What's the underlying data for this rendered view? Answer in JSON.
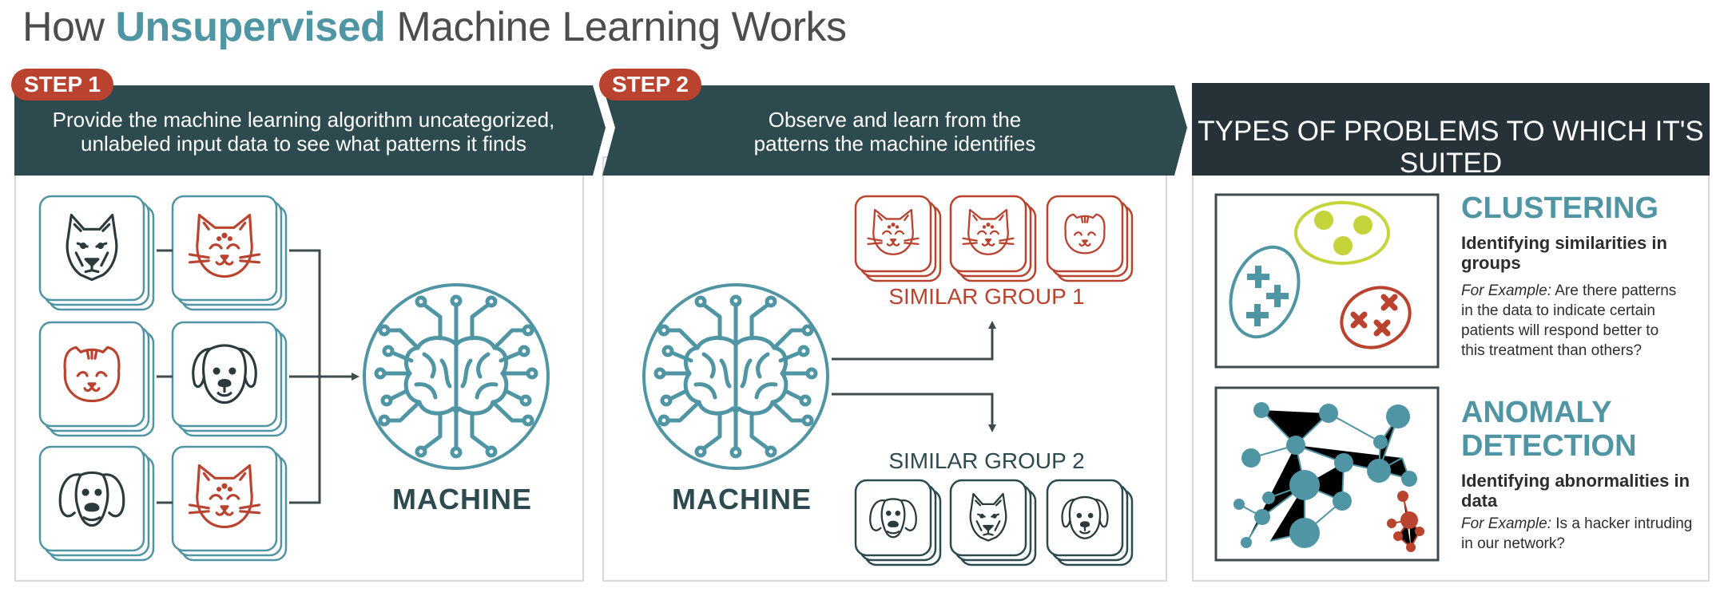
{
  "title": {
    "prefix": "How ",
    "highlight": "Unsupervised",
    "suffix": " Machine Learning Works"
  },
  "step1": {
    "tag": "STEP 1",
    "line1": "Provide the machine learning algorithm uncategorized,",
    "line2": "unlabeled input data to see what patterns it finds",
    "machine_label": "MACHINE"
  },
  "step2": {
    "tag": "STEP 2",
    "line1": "Observe and learn from the",
    "line2": "patterns the machine identifies",
    "machine_label": "MACHINE",
    "group1_label": "SIMILAR GROUP 1",
    "group2_label": "SIMILAR GROUP 2"
  },
  "types": {
    "header": "TYPES OF PROBLEMS TO WHICH IT'S SUITED",
    "clustering": {
      "title": "CLUSTERING",
      "subtitle": "Identifying similarities in groups",
      "example_label": "For Example:",
      "example_text": " Are there patterns in the data to indicate certain patients will respond better to this treatment than others?"
    },
    "anomaly": {
      "title_line1": "ANOMALY",
      "title_line2": "DETECTION",
      "subtitle": "Identifying abnormalities in data",
      "example_label": "For Example:",
      "example_text": " Is a hacker intruding in our network?"
    }
  },
  "colors": {
    "teal": "#4f95a3",
    "dark_teal": "#2d4a4e",
    "red": "#b9432e",
    "navy": "#263238",
    "lime": "#c4d43a"
  },
  "icons": [
    "husky-dog-icon",
    "cat-icon",
    "scottish-fold-cat-icon",
    "floppy-ear-dog-icon",
    "beagle-dog-icon",
    "cat-icon",
    "brain-circuit-icon",
    "cluster-scatter-icon",
    "network-graph-icon"
  ]
}
